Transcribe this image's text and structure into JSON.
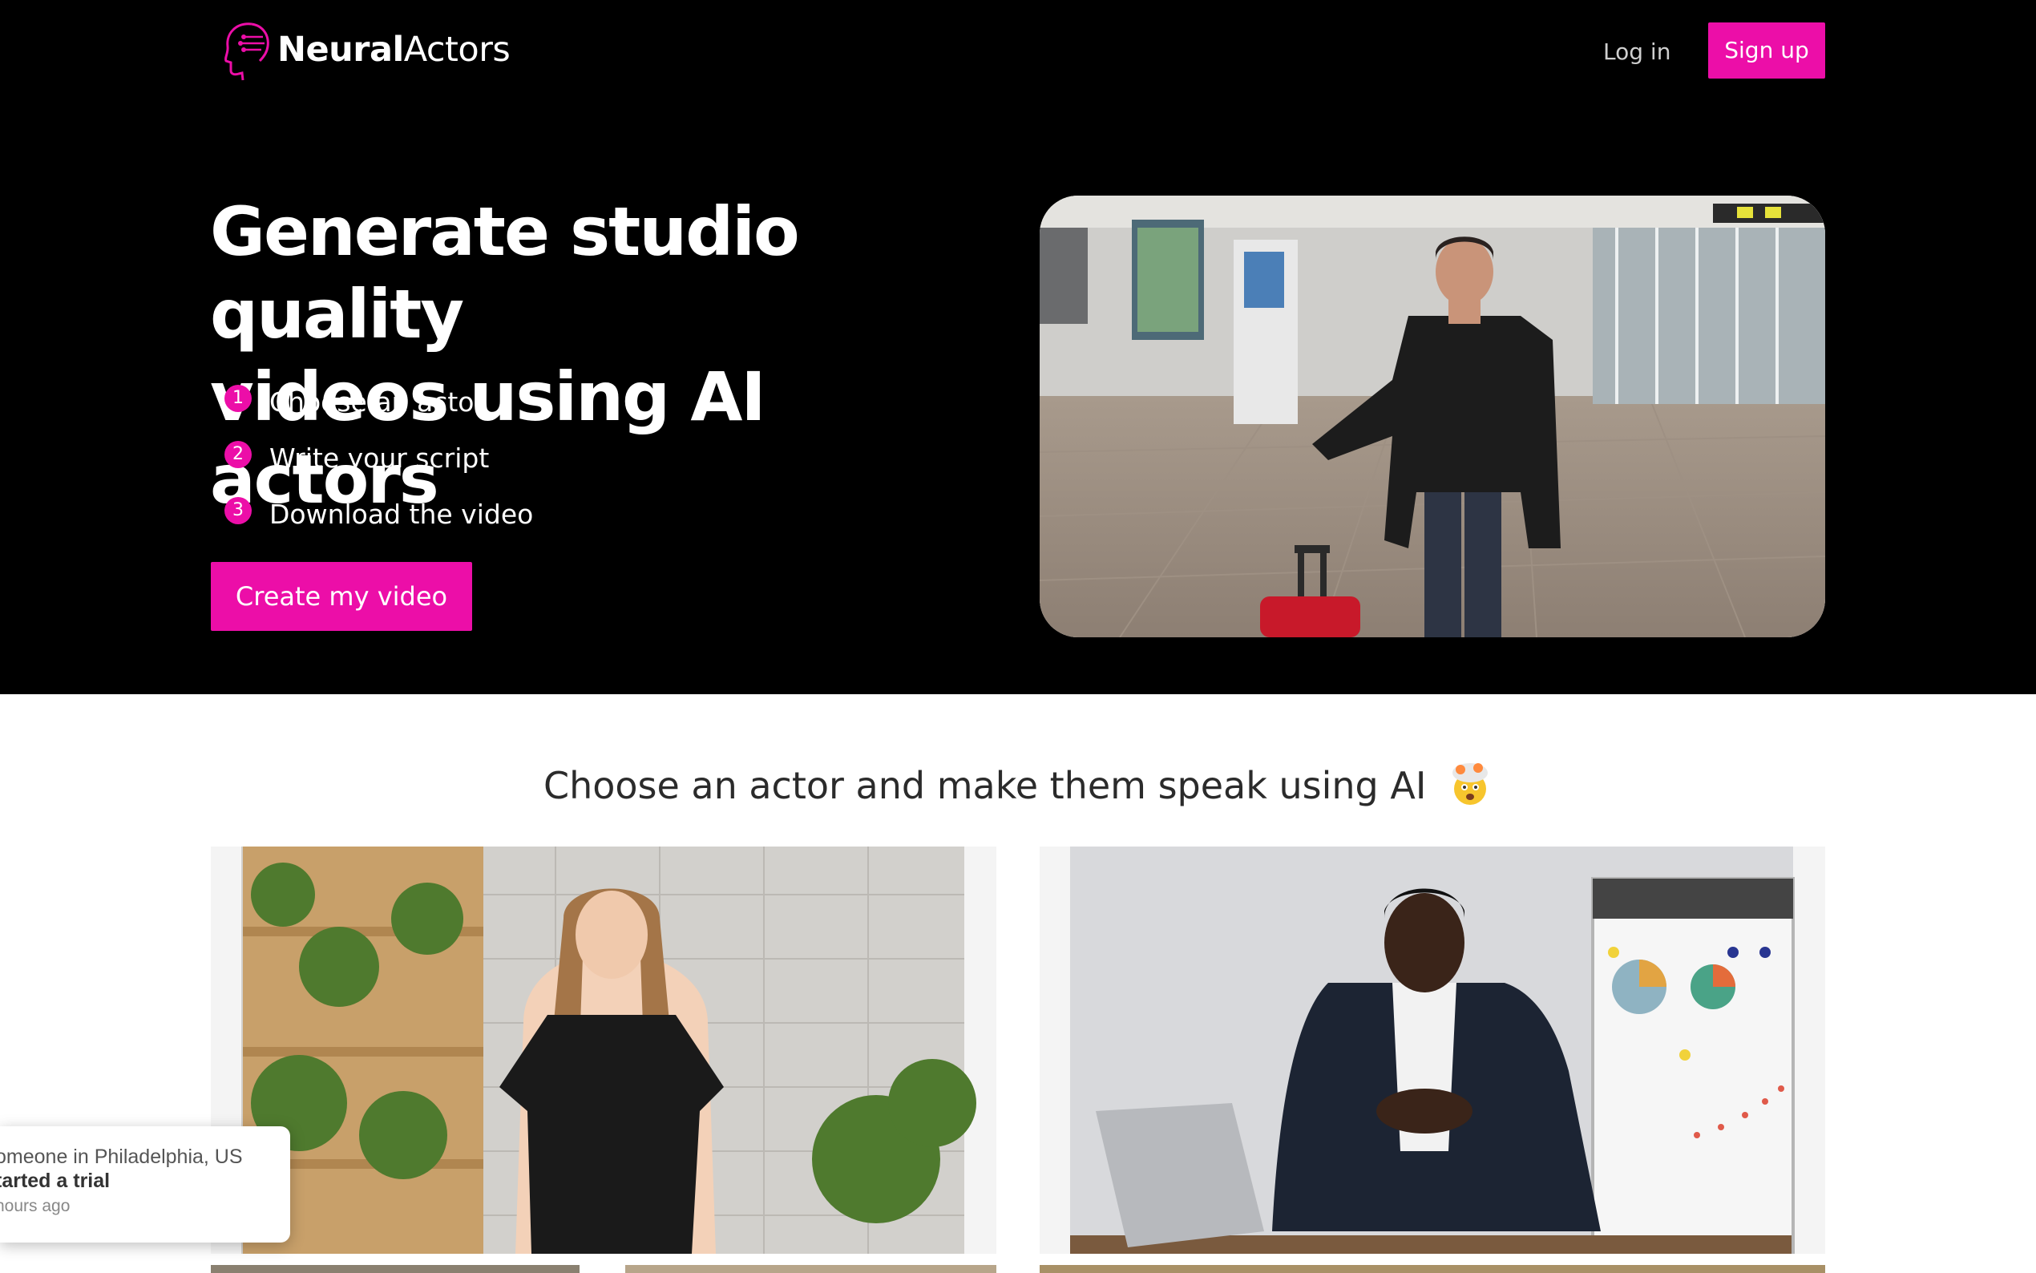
{
  "brand": {
    "name_bold": "Neural",
    "name_regular": "Actors",
    "logo_icon": "head-circuit-icon"
  },
  "nav": {
    "login_label": "Log in",
    "signup_label": "Sign up"
  },
  "hero": {
    "headline_line1": "Generate studio quality",
    "headline_line2": "videos using AI actors",
    "steps": [
      {
        "number": "1",
        "label": "Choose an actor"
      },
      {
        "number": "2",
        "label": "Write your script"
      },
      {
        "number": "3",
        "label": "Download the video"
      }
    ],
    "cta_label": "Create my video"
  },
  "actors_section": {
    "title": "Choose an actor and make them speak using AI",
    "emoji_icon": "exploding-head-emoji"
  },
  "toast": {
    "line1": "omeone in Philadelphia, US",
    "line2": "tarted a trial",
    "line3": "hours ago"
  },
  "colors": {
    "accent": "#ec0ea8",
    "hero_background": "#000000",
    "page_background": "#ffffff"
  }
}
